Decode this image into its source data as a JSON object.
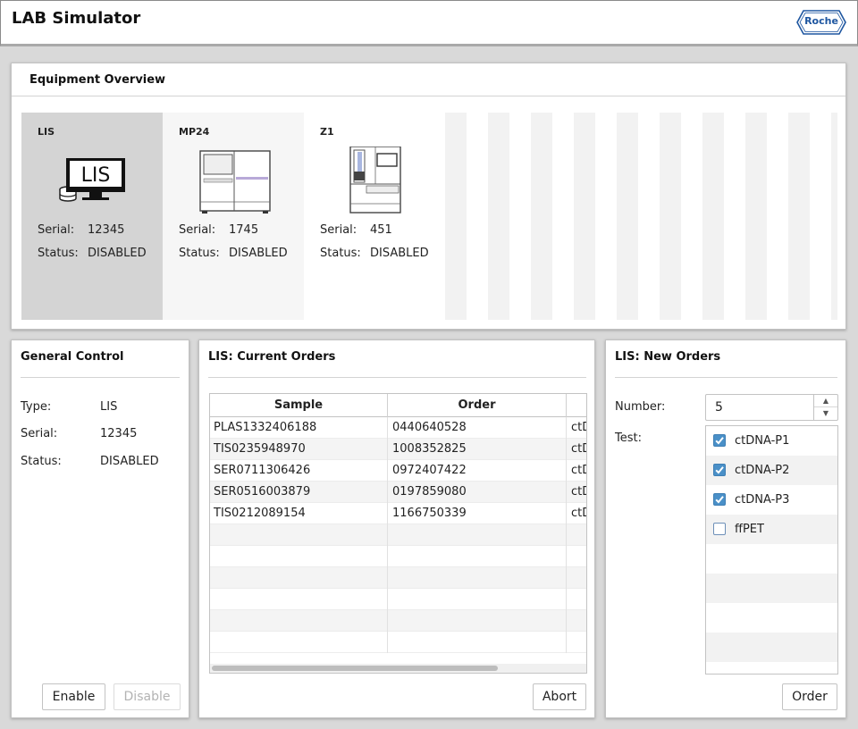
{
  "app": {
    "title": "LAB Simulator",
    "logo_text": "Roche"
  },
  "overview": {
    "title": "Equipment Overview",
    "equipment": [
      {
        "name": "LIS",
        "serial_label": "Serial:",
        "serial": "12345",
        "status_label": "Status:",
        "status": "DISABLED",
        "screen_text": "LIS",
        "selected": true
      },
      {
        "name": "MP24",
        "serial_label": "Serial:",
        "serial": "1745",
        "status_label": "Status:",
        "status": "DISABLED",
        "selected": false
      },
      {
        "name": "Z1",
        "serial_label": "Serial:",
        "serial": "451",
        "status_label": "Status:",
        "status": "DISABLED",
        "selected": false
      }
    ]
  },
  "general": {
    "title": "General Control",
    "type_label": "Type:",
    "type_value": "LIS",
    "serial_label": "Serial:",
    "serial_value": "12345",
    "status_label": "Status:",
    "status_value": "DISABLED",
    "enable_label": "Enable",
    "disable_label": "Disable"
  },
  "current_orders": {
    "title": "LIS: Current Orders",
    "columns": [
      "Sample",
      "Order"
    ],
    "rows": [
      {
        "sample": "PLAS1332406188",
        "order": "0440640528",
        "test": "ctD"
      },
      {
        "sample": "TIS0235948970",
        "order": "1008352825",
        "test": "ctD"
      },
      {
        "sample": "SER0711306426",
        "order": "0972407422",
        "test": "ctD"
      },
      {
        "sample": "SER0516003879",
        "order": "0197859080",
        "test": "ctD"
      },
      {
        "sample": "TIS0212089154",
        "order": "1166750339",
        "test": "ctD"
      }
    ],
    "abort_label": "Abort"
  },
  "new_orders": {
    "title": "LIS: New Orders",
    "number_label": "Number:",
    "number_value": "5",
    "test_label": "Test:",
    "tests": [
      {
        "label": "ctDNA-P1",
        "checked": true
      },
      {
        "label": "ctDNA-P2",
        "checked": true
      },
      {
        "label": "ctDNA-P3",
        "checked": true
      },
      {
        "label": "ffPET",
        "checked": false
      }
    ],
    "order_label": "Order"
  },
  "colors": {
    "accent": "#4a90c8",
    "logo_blue": "#1e56a0",
    "selected_tile": "#d4d4d4"
  }
}
